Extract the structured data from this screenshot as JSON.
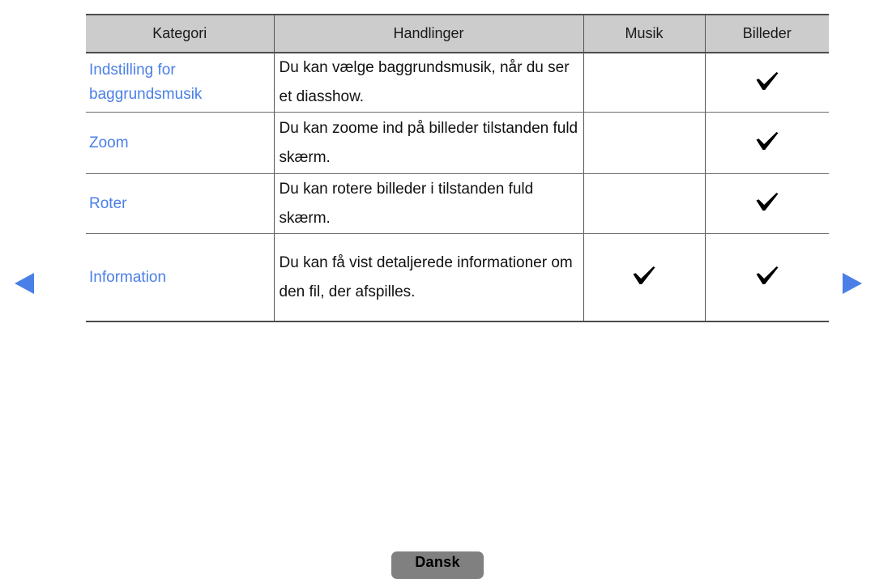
{
  "table": {
    "columns": [
      {
        "key": "kategori",
        "label": "Kategori"
      },
      {
        "key": "handlinger",
        "label": "Handlinger"
      },
      {
        "key": "musik",
        "label": "Musik"
      },
      {
        "key": "billeder",
        "label": "Billeder"
      }
    ],
    "rows": [
      {
        "kategori": "Indstilling for baggrundsmusik",
        "handlinger": "Du kan vælge baggrundsmusik, når du ser et diasshow.",
        "musik": "",
        "billeder": "check-icon"
      },
      {
        "kategori": "Zoom",
        "handlinger": "Du kan zoome ind på billeder tilstanden fuld skærm.",
        "musik": "",
        "billeder": "check-icon"
      },
      {
        "kategori": "Roter",
        "handlinger": "Du kan rotere billeder i tilstanden fuld skærm.",
        "musik": "",
        "billeder": "check-icon"
      },
      {
        "kategori": "Information",
        "handlinger": "Du kan få vist detaljerede informationer om den fil, der afspilles.",
        "musik": "check-icon",
        "billeder": "check-icon"
      }
    ]
  },
  "navigation": {
    "previous_label": "previous-page-arrow",
    "next_label": "next-page-arrow"
  },
  "footer": {
    "language_label": "Dansk"
  },
  "colors": {
    "accent_blue": "#4a7fe8",
    "header_gray": "#cccccc",
    "button_gray": "#808080",
    "border_gray": "#6b6b6b",
    "text_black": "#111111"
  }
}
